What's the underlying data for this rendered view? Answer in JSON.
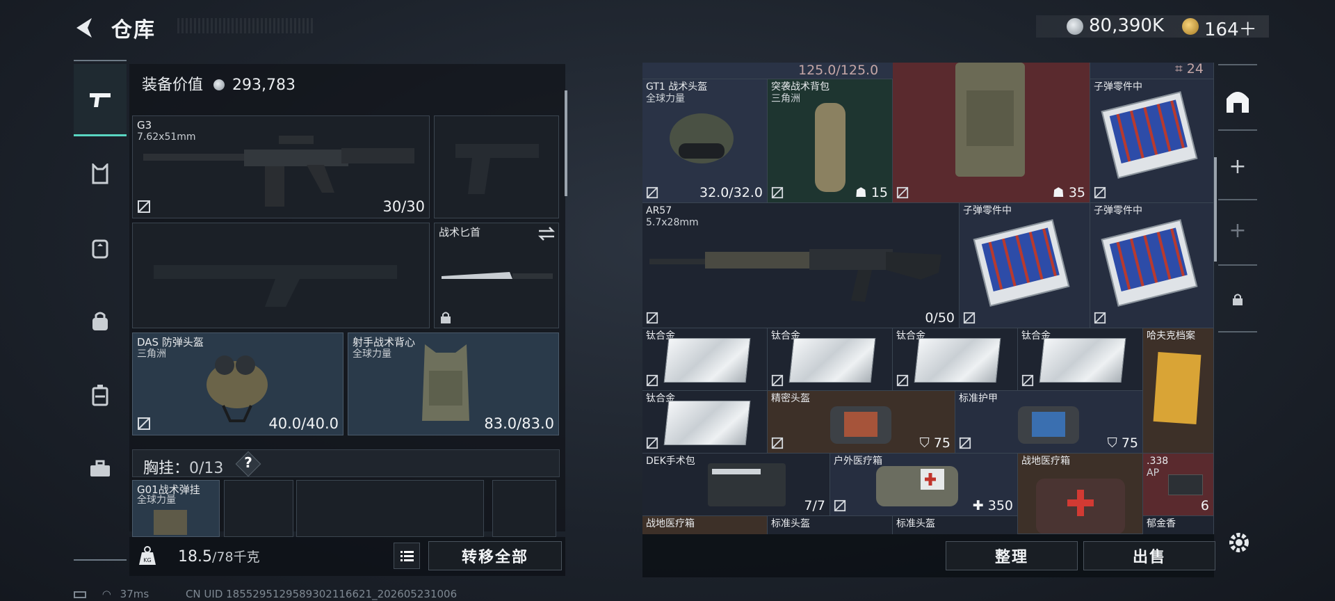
{
  "header": {
    "title": "仓库",
    "currency_primary": "80,390K",
    "currency_secondary": "164＋"
  },
  "left_tabs": [
    {
      "name": "weapon",
      "icon": "pistol-icon",
      "active": true
    },
    {
      "name": "armor",
      "icon": "chest-rig-icon",
      "active": false
    },
    {
      "name": "backpack",
      "icon": "backpack-icon",
      "active": false
    },
    {
      "name": "bag",
      "icon": "bag-icon",
      "active": false
    },
    {
      "name": "case",
      "icon": "case-icon",
      "active": false
    },
    {
      "name": "toolbox",
      "icon": "toolbox-icon",
      "active": false
    }
  ],
  "equipment": {
    "value_label": "装备价值",
    "value": "293,783",
    "primary": {
      "name": "G3",
      "caliber": "7.62x51mm",
      "ammo": "30/30"
    },
    "melee": {
      "name": "战术匕首"
    },
    "helmet": {
      "name": "DAS 防弹头盔",
      "faction": "三角洲",
      "durability": "40.0/40.0"
    },
    "vest": {
      "name": "射手战术背心",
      "faction": "全球力量",
      "durability": "83.0/83.0"
    },
    "chest_label": "胸挂：",
    "chest_count": "0/13",
    "help": "?",
    "chest_rig": {
      "name": "G01战术弹挂",
      "faction": "全球力量"
    },
    "weight": "18.5",
    "weight_max": "/78千克",
    "transfer_all": "转移全部"
  },
  "status": {
    "ping": "37ms",
    "uid": "CN UID 1855295129589302116621_202605231006"
  },
  "stash": {
    "top_partial": "125.0/125.0",
    "top_right_count": "24",
    "items": [
      {
        "id": "gt1",
        "name": "GT1 战术头盔",
        "sub": "全球力量",
        "value": "32.0/32.0"
      },
      {
        "id": "assault-bag",
        "name": "突袭战术背包",
        "sub": "三角洲",
        "value": "15"
      },
      {
        "id": "big-bag",
        "name": "",
        "sub": "",
        "value": "35"
      },
      {
        "id": "bullet-parts-1",
        "name": "子弹零件中",
        "sub": "",
        "value": ""
      },
      {
        "id": "ar57",
        "name": "AR57",
        "sub": "5.7x28mm",
        "value": "0/50"
      },
      {
        "id": "bullet-parts-2",
        "name": "子弹零件中",
        "sub": "",
        "value": ""
      },
      {
        "id": "bullet-parts-3",
        "name": "子弹零件中",
        "sub": "",
        "value": ""
      },
      {
        "id": "ti-1",
        "name": "钛合金",
        "sub": "",
        "value": ""
      },
      {
        "id": "ti-2",
        "name": "钛合金",
        "sub": "",
        "value": ""
      },
      {
        "id": "ti-3",
        "name": "钛合金",
        "sub": "",
        "value": ""
      },
      {
        "id": "ti-4",
        "name": "钛合金",
        "sub": "",
        "value": ""
      },
      {
        "id": "hafuke",
        "name": "哈夫克档案",
        "sub": "",
        "value": ""
      },
      {
        "id": "ti-5",
        "name": "钛合金",
        "sub": "",
        "value": ""
      },
      {
        "id": "precision-helmet",
        "name": "精密头盔",
        "sub": "",
        "value": "75"
      },
      {
        "id": "std-armor",
        "name": "标准护甲",
        "sub": "",
        "value": "75"
      },
      {
        "id": "dek",
        "name": "DEK手术包",
        "sub": "",
        "value": "7/7"
      },
      {
        "id": "outdoor-med",
        "name": "户外医疗箱",
        "sub": "",
        "value": "350"
      },
      {
        "id": "field-med",
        "name": "战地医疗箱",
        "sub": "",
        "value": ""
      },
      {
        "id": "ap338",
        "name": ".338",
        "sub": "AP",
        "value": "6"
      },
      {
        "id": "field-med-2",
        "name": "战地医疗箱",
        "sub": "",
        "value": ""
      },
      {
        "id": "std-helmet-1",
        "name": "标准头盔",
        "sub": "",
        "value": ""
      },
      {
        "id": "std-helmet-2",
        "name": "标准头盔",
        "sub": "",
        "value": ""
      },
      {
        "id": "yujinxiang",
        "name": "郁金香",
        "sub": "",
        "value": ""
      }
    ],
    "sort_button": "整理",
    "sell_button": "出售"
  },
  "right_tools": [
    "safe-box-icon",
    "plus-icon",
    "plus-icon",
    "lock-icon"
  ]
}
